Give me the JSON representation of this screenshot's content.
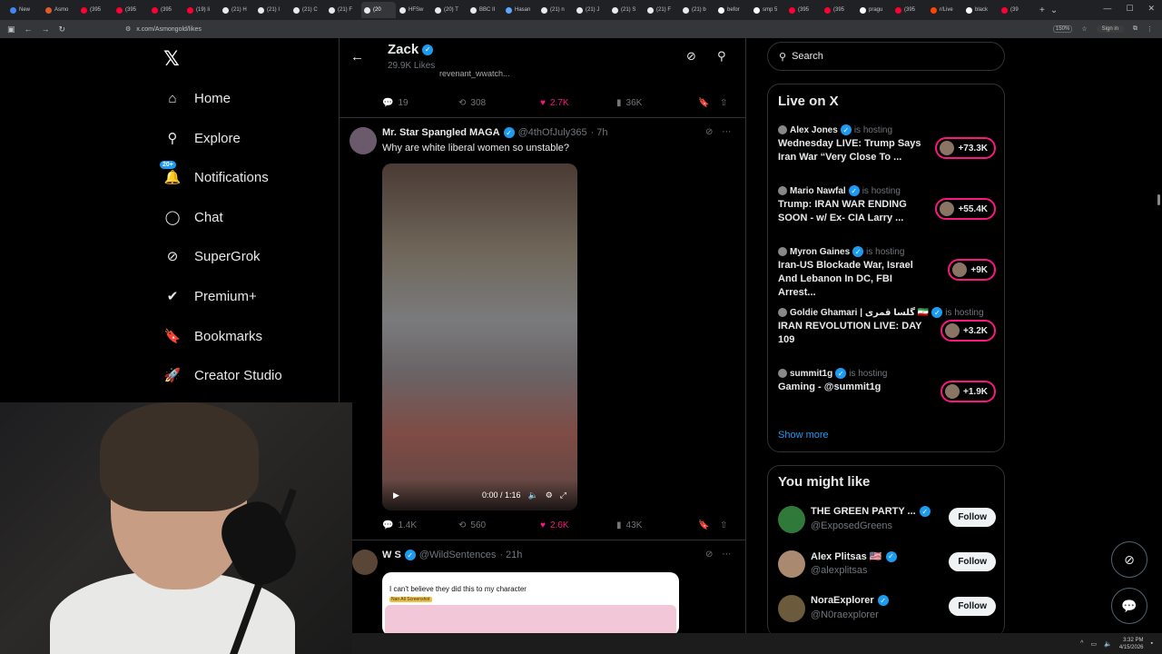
{
  "browser": {
    "tabs": [
      {
        "label": "New",
        "color": "#4285f4"
      },
      {
        "label": "Asmo",
        "color": "#e05a2b"
      },
      {
        "label": "(395",
        "color": "#ff0033"
      },
      {
        "label": "(395",
        "color": "#ff0033"
      },
      {
        "label": "(395",
        "color": "#ff0033"
      },
      {
        "label": "(19) li",
        "color": "#ff0033"
      },
      {
        "label": "(21) H",
        "color": "#e7e9ea"
      },
      {
        "label": "(21) I",
        "color": "#e7e9ea"
      },
      {
        "label": "(21) C",
        "color": "#e7e9ea"
      },
      {
        "label": "(21) F",
        "color": "#e7e9ea"
      },
      {
        "label": "(20",
        "color": "#e7e9ea",
        "active": true
      },
      {
        "label": "HFSw",
        "color": "#e7e9ea"
      },
      {
        "label": "(20) T",
        "color": "#e7e9ea"
      },
      {
        "label": "BBC II",
        "color": "#e7e9ea"
      },
      {
        "label": "Hasan",
        "color": "#5ca8ff"
      },
      {
        "label": "(21) n",
        "color": "#e7e9ea"
      },
      {
        "label": "(21) J",
        "color": "#e7e9ea"
      },
      {
        "label": "(21) S",
        "color": "#e7e9ea"
      },
      {
        "label": "(21) F",
        "color": "#e7e9ea"
      },
      {
        "label": "(21) b",
        "color": "#e7e9ea"
      },
      {
        "label": "befor",
        "color": "#ffffff"
      },
      {
        "label": "smp 5",
        "color": "#ffffff"
      },
      {
        "label": "(395",
        "color": "#ff0033"
      },
      {
        "label": "(395",
        "color": "#ff0033"
      },
      {
        "label": "pragu",
        "color": "#ffffff"
      },
      {
        "label": "(395",
        "color": "#ff0033"
      },
      {
        "label": "r/Live",
        "color": "#ff4500"
      },
      {
        "label": "black",
        "color": "#ffffff"
      },
      {
        "label": "(39",
        "color": "#ff0033"
      }
    ],
    "url": "x.com/Asmongold/likes",
    "zoom": "150%",
    "signin_label": "Sign in"
  },
  "nav": {
    "items": [
      {
        "label": "Home",
        "icon": "home-icon",
        "glyph": "⌂"
      },
      {
        "label": "Explore",
        "icon": "search-icon",
        "glyph": "⚲"
      },
      {
        "label": "Notifications",
        "icon": "bell-icon",
        "glyph": "🔔",
        "badge": "20+"
      },
      {
        "label": "Chat",
        "icon": "chat-icon",
        "glyph": "◯"
      },
      {
        "label": "SuperGrok",
        "icon": "grok-icon",
        "glyph": "⊘"
      },
      {
        "label": "Premium+",
        "icon": "verified-icon",
        "glyph": "✔"
      },
      {
        "label": "Bookmarks",
        "icon": "bookmark-icon",
        "glyph": "🔖"
      },
      {
        "label": "Creator Studio",
        "icon": "rocket-icon",
        "glyph": "🚀"
      }
    ]
  },
  "profile_header": {
    "name": "Zack",
    "subtitle": "29.9K Likes"
  },
  "tweets": [
    {
      "snippet": "revenant_wwatch...",
      "actions": {
        "replies": "19",
        "reposts": "308",
        "likes": "2.7K",
        "views": "36K"
      }
    },
    {
      "author": "Mr. Star Spangled MAGA",
      "handle": "@4thOfJuly365",
      "time": "· 7h",
      "text": "Why are white liberal women so unstable?",
      "video_time": "0:00 / 1:16",
      "actions": {
        "replies": "1.4K",
        "reposts": "560",
        "likes": "2.6K",
        "views": "43K"
      }
    },
    {
      "author": "W S",
      "handle": "@WildSentences",
      "time": "· 21h",
      "image_text": "I can't believe they did this to my character",
      "image_sticker": "Nan All Screenshot"
    }
  ],
  "search": {
    "placeholder": "Search"
  },
  "live": {
    "title": "Live on X",
    "is_hosting": "is hosting",
    "items": [
      {
        "host": "Alex Jones",
        "title": "Wednesday LIVE: Trump Says Iran War “Very Close To ...",
        "count": "+73.3K"
      },
      {
        "host": "Mario Nawfal",
        "title": "Trump: IRAN WAR ENDING SOON - w/ Ex- CIA Larry ...",
        "count": "+55.4K"
      },
      {
        "host": "Myron Gaines",
        "title": "Iran-US Blockade War, Israel And Lebanon In DC, FBI Arrest...",
        "count": "+9K"
      },
      {
        "host": "Goldie Ghamari | گلسا قمری 🇮🇷",
        "title": "IRAN REVOLUTION LIVE: DAY 109",
        "count": "+3.2K"
      },
      {
        "host": "summit1g",
        "title": "Gaming - @summit1g",
        "count": "+1.9K"
      }
    ],
    "show_more": "Show more"
  },
  "suggestions": {
    "title": "You might like",
    "follow_label": "Follow",
    "items": [
      {
        "name": "THE GREEN PARTY ...",
        "handle": "@ExposedGreens",
        "color": "#2f7a3a"
      },
      {
        "name": "Alex Plitsas 🇺🇸",
        "handle": "@alexplitsas",
        "color": "#a98a70"
      },
      {
        "name": "NoraExplorer",
        "handle": "@N0raexplorer",
        "color": "#6b5a3c"
      }
    ]
  },
  "taskbar": {
    "time": "3:32 PM",
    "date": "4/15/2026"
  }
}
